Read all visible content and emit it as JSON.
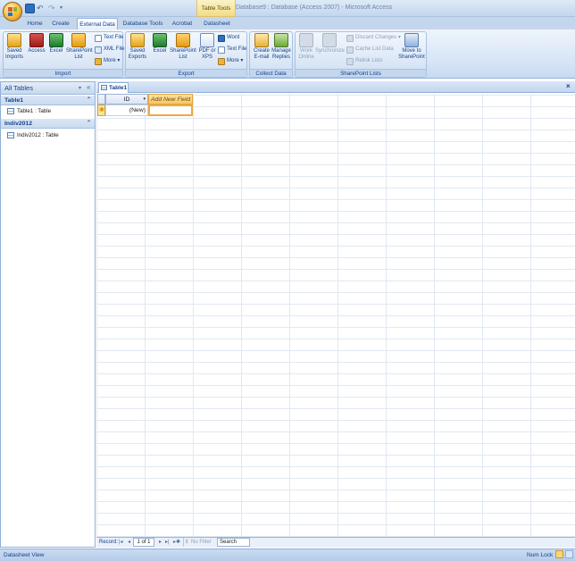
{
  "window": {
    "title": "Database9 : Database (Access 2007) - Microsoft Access",
    "contextual_tab": "Table Tools"
  },
  "tabs": [
    "Home",
    "Create",
    "External Data",
    "Database Tools",
    "Acrobat",
    "Datasheet"
  ],
  "active_tab": "External Data",
  "ribbon": {
    "import": {
      "label": "Import",
      "saved_imports": "Saved Imports",
      "access": "Access",
      "excel": "Excel",
      "sharepoint_list": "SharePoint List",
      "text_file": "Text File",
      "xml_file": "XML File",
      "more": "More"
    },
    "export": {
      "label": "Export",
      "saved_exports": "Saved Exports",
      "excel": "Excel",
      "sharepoint_list": "SharePoint List",
      "pdf_xps": "PDF or XPS",
      "word": "Word",
      "text_file": "Text File",
      "more": "More"
    },
    "collect": {
      "label": "Collect Data",
      "create_email": "Create E-mail",
      "manage_replies": "Manage Replies"
    },
    "sharepoint": {
      "label": "SharePoint Lists",
      "work_online": "Work Online",
      "synchronize": "Synchronize",
      "discard_changes": "Discard Changes",
      "cache_list_data": "Cache List Data",
      "relink_lists": "Relink Lists",
      "move_to_sharepoint": "Move to SharePoint"
    }
  },
  "nav": {
    "header": "All Tables",
    "groups": [
      {
        "name": "Table1",
        "items": [
          "Table1 : Table"
        ]
      },
      {
        "name": "Indiv2012",
        "items": [
          "Indiv2012 : Table"
        ]
      }
    ]
  },
  "document": {
    "tab_label": "Table1",
    "columns": [
      "ID",
      "Add New Field"
    ],
    "new_row_value": "(New)"
  },
  "record_nav": {
    "label": "Record:",
    "position": "1 of 1",
    "filter": "No Filter",
    "search": "Search"
  },
  "status": {
    "view": "Datasheet View",
    "num_lock": "Num Lock"
  },
  "colors": {
    "ribbon_bg": "#d6e4f5",
    "accent": "#15428b",
    "contextual": "#f1dc86",
    "new_field_header": "#fbd891"
  }
}
